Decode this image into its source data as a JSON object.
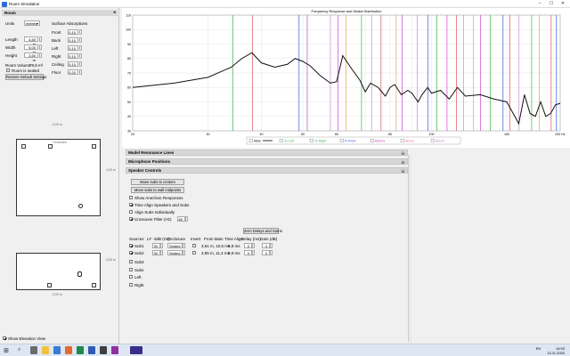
{
  "window": {
    "title": "Room Simulation",
    "min": "–",
    "max": "☐",
    "close": "✕"
  },
  "room": {
    "header": "Room",
    "units_label": "Units",
    "units_value": "metres",
    "length_label": "Length",
    "length_value": "4,50 m",
    "width_label": "Width",
    "width_value": "5,00 m",
    "height_label": "Height",
    "height_value": "3,50 m",
    "surface_title": "Surface Absorptions",
    "surfaces": [
      {
        "label": "Front",
        "value": "0,10"
      },
      {
        "label": "Back",
        "value": "0,10"
      },
      {
        "label": "Left",
        "value": "0,10"
      },
      {
        "label": "Right",
        "value": "0,10"
      },
      {
        "label": "Ceiling",
        "value": "0,10"
      },
      {
        "label": "Floor",
        "value": "0,20"
      }
    ],
    "volume_label": "Room Volume",
    "volume_value": "78,8 m³",
    "sealed_label": "Room is sealed",
    "reset_button": "Restore Default Settings"
  },
  "plan": {
    "top_dim": "5,00 m",
    "side_dim": "4,50 m",
    "top_view": "TV/screen"
  },
  "elev": {
    "side_dim": "3,50 m",
    "bottom_dim": "5,00 m"
  },
  "show_elevation_label": "Show Elevation View",
  "chart": {
    "title": "Frequency Response and Modal Distribution",
    "y_ticks": [
      "110",
      "100",
      "90",
      "80",
      "70",
      "60",
      "50",
      "40",
      "30"
    ],
    "x_ticks": [
      "20",
      "30",
      "40",
      "50",
      "60",
      "80",
      "100",
      "150",
      "200 Hz"
    ],
    "legend": [
      {
        "label": "Main",
        "color": "#000000"
      },
      {
        "label": "To Left",
        "color": "#3cb34b"
      },
      {
        "label": "To Right",
        "color": "#3cb34b"
      },
      {
        "label": "In Front",
        "color": "#3355dd"
      },
      {
        "label": "Behind",
        "color": "#cc44cc"
      },
      {
        "label": "Above",
        "color": "#f06aa8"
      },
      {
        "label": "Below",
        "color": "#c48ccc"
      }
    ]
  },
  "chart_data": {
    "type": "line",
    "title": "Frequency Response and Modal Distribution",
    "x_scale": "log",
    "xlim": [
      20,
      200
    ],
    "ylim": [
      30,
      110
    ],
    "grid": true,
    "legend_position": "bottom",
    "series": [
      {
        "name": "Main",
        "x": [
          20,
          25,
          30,
          34,
          36,
          38,
          40,
          43,
          46,
          48,
          50,
          52,
          55,
          58,
          60,
          62,
          65,
          68,
          70,
          72,
          75,
          78,
          80,
          82,
          85,
          88,
          90,
          93,
          95,
          98,
          100,
          105,
          110,
          115,
          120,
          130,
          140,
          150,
          160,
          165,
          170,
          175,
          180,
          185,
          190,
          195,
          200
        ],
        "y": [
          60,
          63,
          67,
          74,
          80,
          84,
          77,
          74,
          76,
          80,
          78,
          75,
          68,
          63,
          64,
          82,
          73,
          65,
          57,
          63,
          60,
          54,
          60,
          62,
          55,
          58,
          56,
          50,
          55,
          60,
          56,
          58,
          52,
          60,
          54,
          55,
          52,
          50,
          35,
          55,
          42,
          40,
          50,
          40,
          42,
          48,
          49
        ]
      }
    ],
    "mode_lines": [
      {
        "color": "#e05050",
        "x": [
          38.1,
          76.2,
          114.3,
          152.4,
          190.5
        ]
      },
      {
        "color": "#3cb34b",
        "x": [
          34.3,
          68.6,
          102.9,
          137.2,
          171.5
        ]
      },
      {
        "color": "#3355dd",
        "x": [
          49.0,
          98.0,
          147.0,
          196.0
        ]
      },
      {
        "color": "#cc44cc",
        "x": [
          51.2,
          60.5,
          85.3,
          108.7,
          130.1
        ]
      },
      {
        "color": "#c48ccc",
        "x": [
          58.0,
          72.4,
          92.6,
          118.8,
          160.2
        ]
      },
      {
        "color": "#e8a060",
        "x": [
          63.1,
          82.7,
          125.4,
          178.6
        ]
      }
    ]
  },
  "sections": {
    "modal": "Model Resonance Lines",
    "mic": "Microphone Positions",
    "speaker": "Speaker Controls"
  },
  "speaker": {
    "move_center": "Move subs to centers",
    "move_mid": "Move subs to wall midpoints",
    "show_anechoic": "Show Anechoic Responses",
    "time_align": "Time Align Speakers and Subs",
    "align_subs": "Align Subs Individually",
    "crossover_label": "Crossover Filter (Hz)",
    "crossover_value": "80",
    "zero_button": "Zero Delays and Gains",
    "headers": [
      "Sources",
      "LF -3dB (Hz)",
      "Enclosure",
      "Invert",
      "From Main",
      "Time Align",
      "Delay (ms)",
      "Gain (dB)"
    ],
    "rows": [
      {
        "name": "Sub1",
        "checked": true,
        "lf": "30",
        "enclosure": "Sealed",
        "from": "3,61 m, 10,5 ms",
        "align": "6,9 ms",
        "delay": "0",
        "gain": "0"
      },
      {
        "name": "Sub2",
        "checked": true,
        "lf": "30",
        "enclosure": "Sealed",
        "from": "3,95 m, 11,4 ms",
        "align": "6,9 ms",
        "delay": "0",
        "gain": "0"
      }
    ],
    "others": [
      "Sub3",
      "Subs",
      "Left",
      "Right"
    ]
  },
  "taskbar": {
    "time": "14:53",
    "date": "13.11.2020",
    "lang": "EN"
  }
}
